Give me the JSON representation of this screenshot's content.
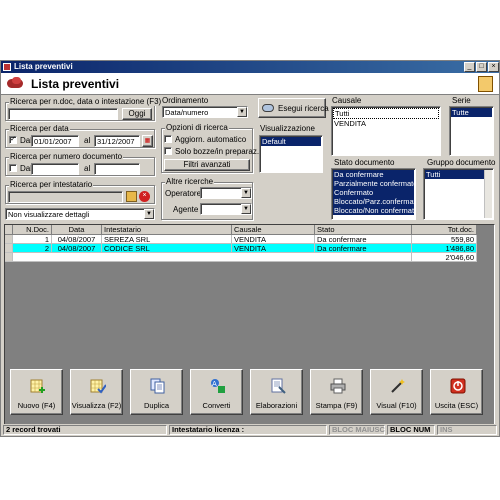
{
  "window": {
    "title": "Lista preventivi",
    "controls": [
      "_",
      "□",
      "×"
    ]
  },
  "header": {
    "title": "Lista preventivi"
  },
  "search_text": {
    "label": "Ricerca per n.doc, data o intestazione (F3)",
    "value": "",
    "button": "Oggi"
  },
  "date_search": {
    "label": "Ricerca per data",
    "dal_label": "Dal",
    "dal_checked": true,
    "dal_value": "01/01/2007",
    "al_label": "al",
    "al_value": "31/12/2007"
  },
  "number_search": {
    "label": "Ricerca per numero documento",
    "dal_label": "Dal",
    "dal_value": "",
    "al_label": "al",
    "al_value": ""
  },
  "holder_search": {
    "label": "Ricerca per intestatario",
    "value": ""
  },
  "details_select": {
    "value": "Non visualizzare dettagli"
  },
  "ordinamento": {
    "label": "Ordinamento",
    "value": "Data/numero"
  },
  "opzioni": {
    "label": "Opzioni di ricerca",
    "auto_label": "Aggiorn. automatico",
    "bozze_label": "Solo bozze/in preparaz.",
    "filter_button": "Filtri avanzati"
  },
  "altre": {
    "label": "Altre ricerche",
    "operatore_label": "Operatore :",
    "operatore_value": "",
    "agente_label": "Agente :",
    "agente_value": ""
  },
  "esegui": {
    "label": "Esegui ricerca"
  },
  "visualizzazione": {
    "label": "Visualizzazione",
    "items": [
      "Default"
    ]
  },
  "causale": {
    "label": "Causale",
    "items": [
      "Tutti",
      "VENDITA"
    ]
  },
  "serie": {
    "label": "Serie",
    "items": [
      "Tutte"
    ]
  },
  "stato": {
    "label": "Stato documento",
    "items": [
      "Da confermare",
      "Parzialmente confermato",
      "Confermato",
      "Bloccato/Parz.confermato",
      "Bloccato/Non confermato"
    ]
  },
  "gruppo": {
    "label": "Gruppo documento",
    "items": [
      "Tutti"
    ]
  },
  "table": {
    "headers": [
      "N.Doc.",
      "Data",
      "Intestatario",
      "Causale",
      "Stato",
      "Tot.doc."
    ],
    "rows": [
      {
        "n": "1",
        "data": "04/08/2007",
        "intestatario": "SEREZA SRL",
        "causale": "VENDITA",
        "stato": "Da confermare",
        "tot": "559,80"
      },
      {
        "n": "2",
        "data": "04/08/2007",
        "intestatario": "CODICE SRL",
        "causale": "VENDITA",
        "stato": "Da confermare",
        "tot": "1'486,80"
      }
    ],
    "total": "2'046,60"
  },
  "toolbar": [
    "Nuovo (F4)",
    "Visualizza (F2)",
    "Duplica",
    "Converti",
    "Elaborazioni",
    "Stampa (F9)",
    "Visual (F10)",
    "Uscita (ESC)"
  ],
  "status": {
    "records": "2 record trovati",
    "licenza": "Intestatario licenza :",
    "caps": "BLOC MAIUSC",
    "num": "BLOC NUM",
    "ins": "INS"
  }
}
